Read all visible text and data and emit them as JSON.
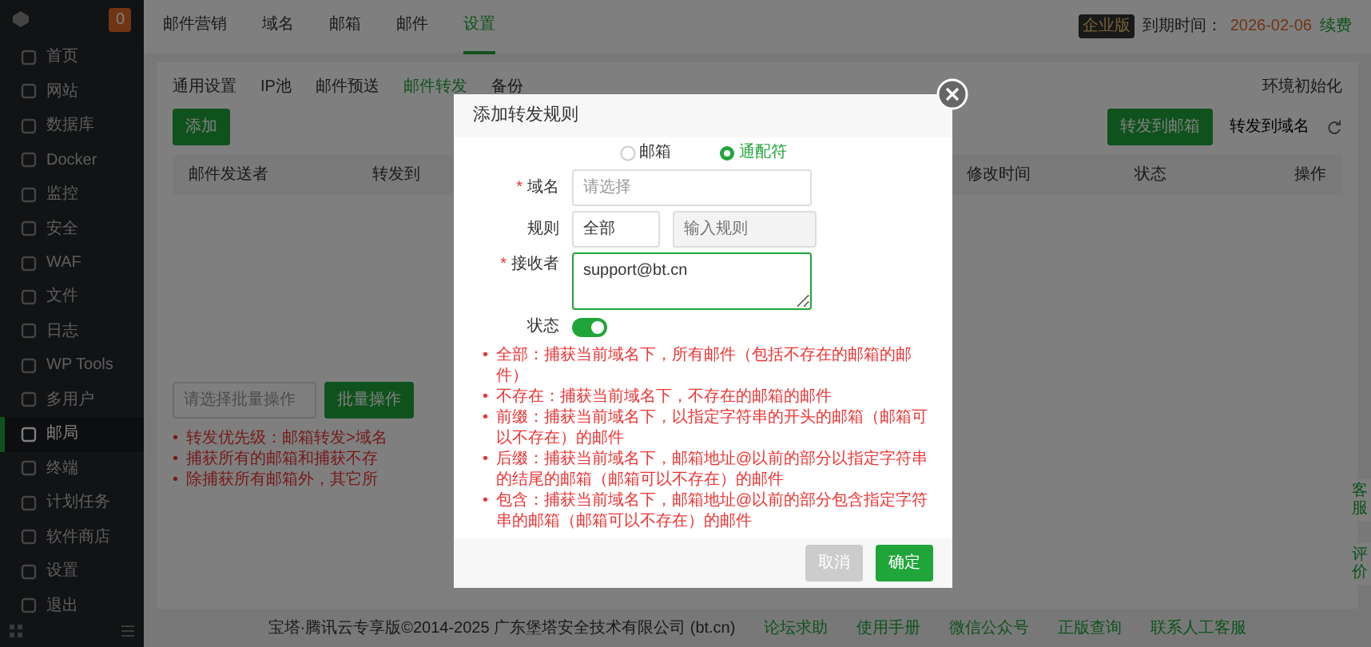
{
  "sidebar": {
    "badge": "0",
    "items": [
      {
        "label": "首页",
        "selected": false
      },
      {
        "label": "网站",
        "selected": false
      },
      {
        "label": "数据库",
        "selected": false
      },
      {
        "label": "Docker",
        "selected": false
      },
      {
        "label": "监控",
        "selected": false
      },
      {
        "label": "安全",
        "selected": false
      },
      {
        "label": "WAF",
        "selected": false
      },
      {
        "label": "文件",
        "selected": false
      },
      {
        "label": "日志",
        "selected": false
      },
      {
        "label": "WP Tools",
        "selected": false
      },
      {
        "label": "多用户",
        "selected": false
      },
      {
        "label": "邮局",
        "selected": true
      },
      {
        "label": "终端",
        "selected": false
      },
      {
        "label": "计划任务",
        "selected": false
      },
      {
        "label": "软件商店",
        "selected": false
      },
      {
        "label": "设置",
        "selected": false
      },
      {
        "label": "退出",
        "selected": false
      }
    ]
  },
  "top_nav": {
    "tabs": [
      {
        "label": "邮件营销",
        "selected": false
      },
      {
        "label": "域名",
        "selected": false
      },
      {
        "label": "邮箱",
        "selected": false
      },
      {
        "label": "邮件",
        "selected": false
      },
      {
        "label": "设置",
        "selected": true
      }
    ],
    "edition": "企业版",
    "expiry_label": "到期时间：",
    "expiry_date": "2026-02-06",
    "renew": "续费"
  },
  "sub_tabs": [
    {
      "label": "通用设置",
      "selected": false
    },
    {
      "label": "IP池",
      "selected": false
    },
    {
      "label": "邮件预送",
      "selected": false
    },
    {
      "label": "邮件转发",
      "selected": true
    },
    {
      "label": "备份",
      "selected": false
    }
  ],
  "env_init": "环境初始化",
  "add_button": "添加",
  "forward_toggle": [
    {
      "label": "转发到邮箱",
      "selected": true
    },
    {
      "label": "转发到域名",
      "selected": false
    }
  ],
  "table": {
    "columns": [
      "邮件发送者",
      "转发到",
      "修改时间",
      "状态",
      "操作"
    ]
  },
  "bulk": {
    "placeholder": "请选择批量操作",
    "button": "批量操作"
  },
  "notes": [
    {
      "bullet": "•",
      "text": "转发优先级：邮箱转发>域名"
    },
    {
      "bullet": "•",
      "text": "捕获所有的邮箱和捕获不存"
    },
    {
      "bullet": "•",
      "text": "除捕获所有邮箱外，其它所"
    }
  ],
  "modal": {
    "title": "添加转发规则",
    "types": [
      {
        "label": "邮箱",
        "selected": false
      },
      {
        "label": "通配符",
        "selected": true
      }
    ],
    "domain": {
      "label": "域名",
      "required_mark": "*",
      "placeholder": "请选择"
    },
    "rule": {
      "label": "规则",
      "value": "全部",
      "placeholder": "输入规则"
    },
    "recipient": {
      "label": "接收者",
      "required_mark": "*",
      "value": "support@bt.cn"
    },
    "status": {
      "label": "状态",
      "on": true
    },
    "notes": [
      {
        "bullet": "•",
        "text": "全部：捕获当前域名下，所有邮件（包括不存在的邮箱的邮件）"
      },
      {
        "bullet": "•",
        "text": "不存在：捕获当前域名下，不存在的邮箱的邮件"
      },
      {
        "bullet": "•",
        "text": "前缀：捕获当前域名下，以指定字符串的开头的邮箱（邮箱可以不存在）的邮件"
      },
      {
        "bullet": "•",
        "text": "后缀：捕获当前域名下，邮箱地址@以前的部分以指定字符串的结尾的邮箱（邮箱可以不存在）的邮件"
      },
      {
        "bullet": "•",
        "text": "包含：捕获当前域名下，邮箱地址@以前的部分包含指定字符串的邮箱（邮箱可以不存在）的邮件"
      }
    ],
    "cancel": "取消",
    "confirm": "确定"
  },
  "footer": {
    "copyright": "宝塔·腾讯云专享版©2014-2025 广东堡塔安全技术有限公司 (bt.cn)",
    "links": [
      "论坛求助",
      "使用手册",
      "微信公众号",
      "正版查询",
      "联系人工客服"
    ]
  },
  "float_buttons": [
    "客服",
    "评价"
  ]
}
